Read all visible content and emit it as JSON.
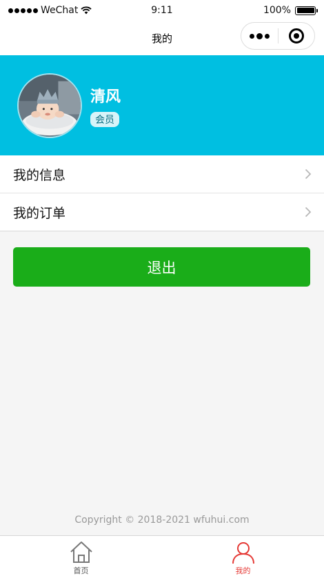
{
  "status_bar": {
    "carrier": "WeChat",
    "time": "9:11",
    "battery_percent": "100%",
    "battery_level": 1.0
  },
  "nav": {
    "title": "我的"
  },
  "profile": {
    "username": "清风",
    "badge": "会员",
    "header_color": "#00bfe1"
  },
  "menu": {
    "items": [
      {
        "label": "我的信息"
      },
      {
        "label": "我的订单"
      }
    ]
  },
  "logout": {
    "label": "退出",
    "color": "#1aad19"
  },
  "footer": {
    "copyright": "Copyright © 2018-2021 wfuhui.com"
  },
  "tabbar": {
    "items": [
      {
        "label": "首页",
        "icon": "home-icon",
        "active": false
      },
      {
        "label": "我的",
        "icon": "user-icon",
        "active": true
      }
    ],
    "active_color": "#e53935"
  }
}
